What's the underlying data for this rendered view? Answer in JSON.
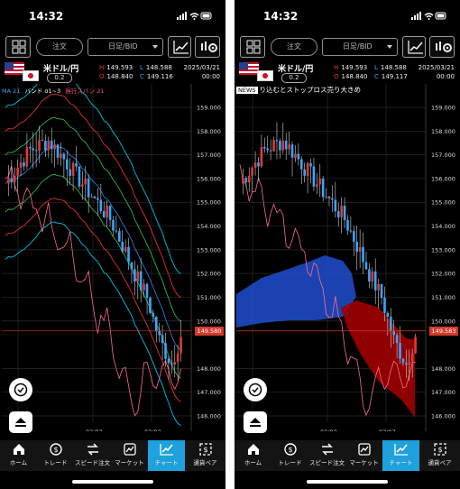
{
  "status": {
    "time": "14:32"
  },
  "toolbar": {
    "order": "注文",
    "timeframe": "日足/BID"
  },
  "pair": {
    "name": "米ドル/円",
    "spread": "0.2"
  },
  "left": {
    "high": "149.593",
    "low": "148.588",
    "open": "148.840",
    "close": "149.116",
    "date": "2025/03/21",
    "time": "00:00",
    "legend": {
      "ma": "MA 21",
      "band": "バンド σ1~3",
      "lagging": "遅行スパン 21"
    },
    "price_label": "149.580",
    "price_ticks": [
      "159.000",
      "158.000",
      "157.000",
      "156.000",
      "155.000",
      "154.000",
      "153.000",
      "152.000",
      "151.000",
      "150.000",
      "148.000",
      "147.000",
      "146.000"
    ],
    "date_ticks": [
      "01/02",
      "02/03",
      "03/03"
    ]
  },
  "right": {
    "high": "149.593",
    "low": "148.588",
    "open": "148.840",
    "close": "149.117",
    "date": "2025/03/21",
    "time": "00:00",
    "news_tag": "NEWS",
    "news_text": "り込むとストップロス売り大きめ",
    "price_label": "149.583",
    "price_ticks": [
      "159.000",
      "158.000",
      "157.000",
      "156.000",
      "155.000",
      "154.000",
      "153.000",
      "152.000",
      "151.000",
      "150.000",
      "148.000",
      "147.000",
      "146.000"
    ],
    "date_ticks": [
      "01/02",
      "02/03",
      "03/03"
    ]
  },
  "labels": {
    "H": "H",
    "L": "L",
    "O": "O",
    "C": "C"
  },
  "tabs": [
    {
      "label": "ホーム",
      "icon": "home-icon"
    },
    {
      "label": "トレード",
      "icon": "trade-icon"
    },
    {
      "label": "スピード注文",
      "icon": "speed-order-icon"
    },
    {
      "label": "マーケット",
      "icon": "market-icon"
    },
    {
      "label": "チャート",
      "icon": "chart-icon",
      "active": true
    },
    {
      "label": "通貨ペア",
      "icon": "currency-pair-icon"
    }
  ],
  "colors": {
    "up": "#e03a3a",
    "down": "#38a5ff",
    "accent": "#1ea1dc",
    "price_line": "#d23a2a"
  }
}
